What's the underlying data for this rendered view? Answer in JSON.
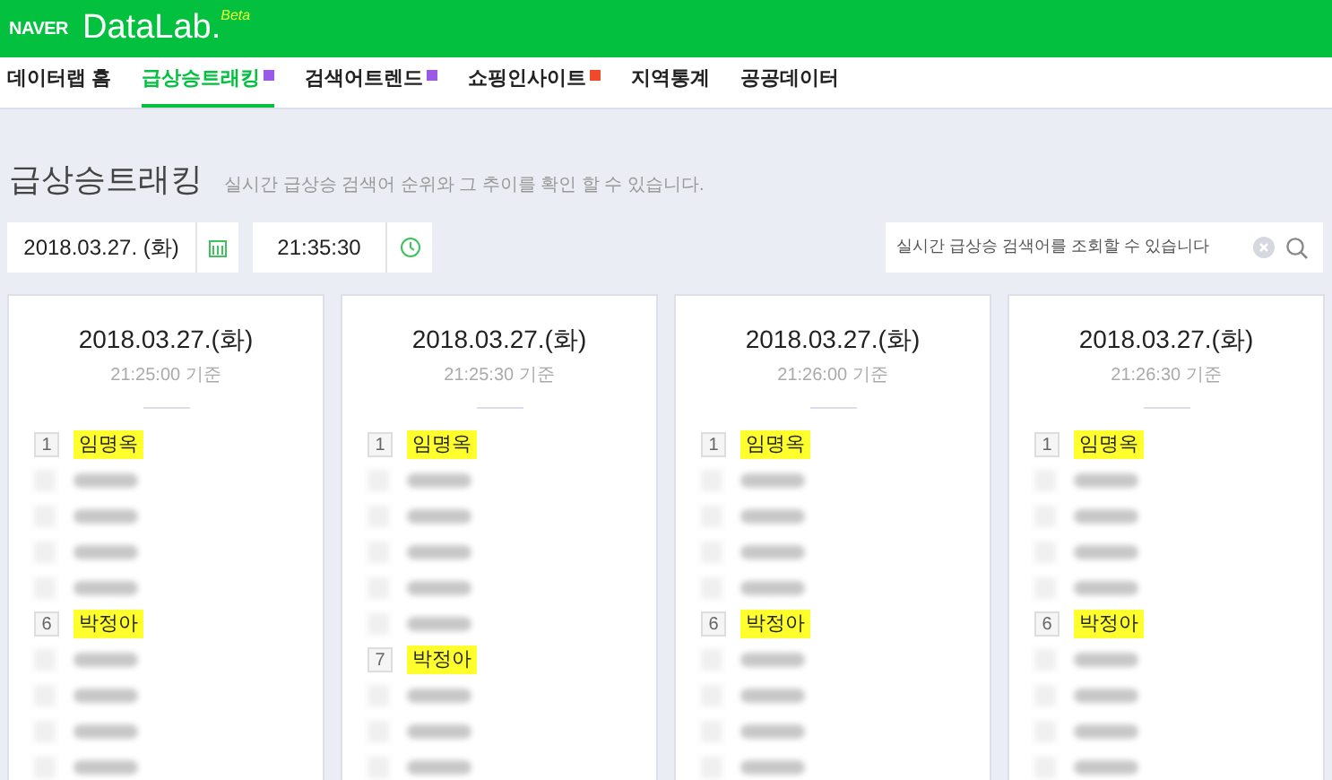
{
  "header": {
    "brand": "NAVER",
    "logo": "DataLab.",
    "logo_tag": "Beta"
  },
  "nav": [
    {
      "label": "데이터랩 홈",
      "selected": false
    },
    {
      "label": "급상승트래킹",
      "selected": true,
      "color": "#9b59e6"
    },
    {
      "label": "검색어트렌드",
      "selected": false,
      "color": "#9b59e6"
    },
    {
      "label": "쇼핑인사이트",
      "selected": false,
      "color": "#f04a2a"
    },
    {
      "label": "지역통계",
      "selected": false
    },
    {
      "label": "공공데이터",
      "selected": false
    }
  ],
  "page": {
    "title": "급상승트래킹",
    "subtitle": "실시간 급상승 검색어 순위와 그 추이를 확인 할 수 있습니다."
  },
  "controls": {
    "date": "2018.03.27. (화)",
    "time": "21:35:30",
    "search": {
      "placeholder": "실시간 급상승 검색어를 조회할 수 있습니다"
    }
  },
  "cards": [
    {
      "date": "2018.03.27.(화)",
      "basis": "21:25:00 기준",
      "rows": [
        {
          "kind": "shown",
          "rank": "1",
          "term": "임명옥",
          "highlighted": true
        },
        {
          "kind": "blurred"
        },
        {
          "kind": "blurred"
        },
        {
          "kind": "blurred"
        },
        {
          "kind": "blurred"
        },
        {
          "kind": "shown",
          "rank": "6",
          "term": "박정아",
          "highlighted": true
        },
        {
          "kind": "blurred"
        },
        {
          "kind": "blurred"
        },
        {
          "kind": "blurred"
        },
        {
          "kind": "blurred"
        }
      ]
    },
    {
      "date": "2018.03.27.(화)",
      "basis": "21:25:30 기준",
      "rows": [
        {
          "kind": "shown",
          "rank": "1",
          "term": "임명옥",
          "highlighted": true
        },
        {
          "kind": "blurred"
        },
        {
          "kind": "blurred"
        },
        {
          "kind": "blurred"
        },
        {
          "kind": "blurred"
        },
        {
          "kind": "blurred"
        },
        {
          "kind": "shown",
          "rank": "7",
          "term": "박정아",
          "highlighted": true
        },
        {
          "kind": "blurred"
        },
        {
          "kind": "blurred"
        },
        {
          "kind": "blurred"
        }
      ]
    },
    {
      "date": "2018.03.27.(화)",
      "basis": "21:26:00 기준",
      "rows": [
        {
          "kind": "shown",
          "rank": "1",
          "term": "임명옥",
          "highlighted": true
        },
        {
          "kind": "blurred"
        },
        {
          "kind": "blurred"
        },
        {
          "kind": "blurred"
        },
        {
          "kind": "blurred"
        },
        {
          "kind": "shown",
          "rank": "6",
          "term": "박정아",
          "highlighted": true
        },
        {
          "kind": "blurred"
        },
        {
          "kind": "blurred"
        },
        {
          "kind": "blurred"
        },
        {
          "kind": "blurred"
        }
      ]
    },
    {
      "date": "2018.03.27.(화)",
      "basis": "21:26:30 기준",
      "rows": [
        {
          "kind": "shown",
          "rank": "1",
          "term": "임명옥",
          "highlighted": true
        },
        {
          "kind": "blurred"
        },
        {
          "kind": "blurred"
        },
        {
          "kind": "blurred"
        },
        {
          "kind": "blurred"
        },
        {
          "kind": "shown",
          "rank": "6",
          "term": "박정아",
          "highlighted": true
        },
        {
          "kind": "blurred"
        },
        {
          "kind": "blurred"
        },
        {
          "kind": "blurred"
        },
        {
          "kind": "blurred"
        }
      ]
    }
  ]
}
